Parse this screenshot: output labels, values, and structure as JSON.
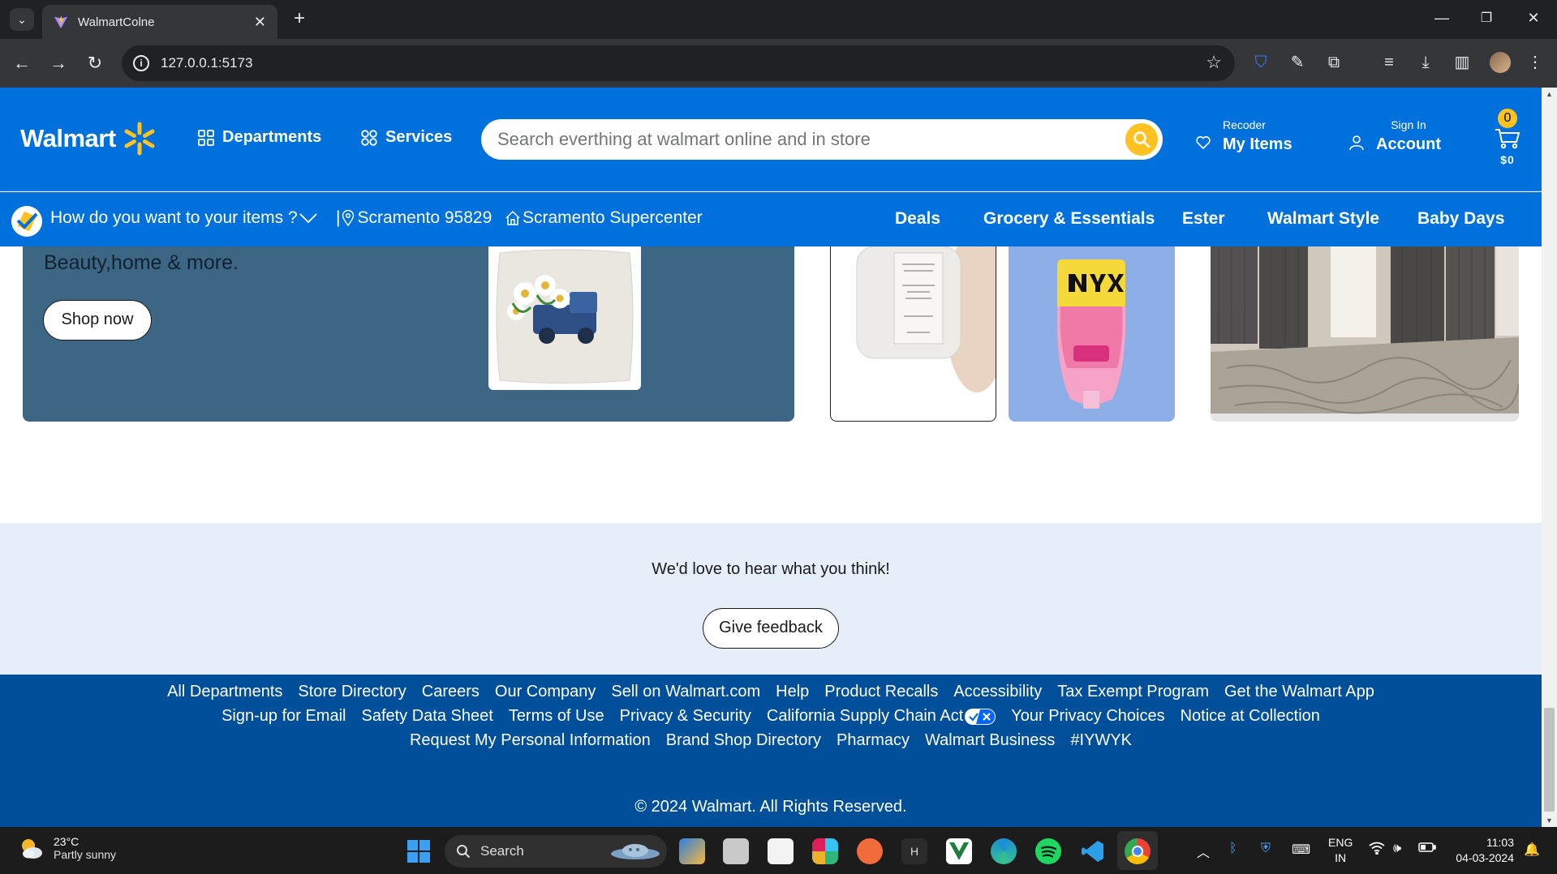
{
  "browser": {
    "tab_title": "WalmartColne",
    "url": "127.0.0.1:5173"
  },
  "header": {
    "logo_text": "Walmart",
    "departments_label": "Departments",
    "services_label": "Services",
    "search_placeholder": "Search everthing at walmart online and in store",
    "reorder_small": "Recoder",
    "reorder_big": "My Items",
    "signin_small": "Sign In",
    "signin_big": "Account",
    "cart_count": "0",
    "cart_total": "$0",
    "brand_color": "#0071dc",
    "accent_color": "#ffc220"
  },
  "sub_nav": {
    "delivery_prompt": "How do you want to your items ?",
    "zip_label": "Scramento 95829",
    "store_label": "Scramento Supercenter",
    "links": [
      "Deals",
      "Grocery & Essentials",
      "Ester",
      "Walmart Style",
      "Baby Days"
    ]
  },
  "hero": {
    "subtitle": "Beauty,home & more.",
    "cta_label": "Shop now"
  },
  "feedback": {
    "prompt": "We'd love to hear what you think!",
    "button_label": "Give feedback"
  },
  "footer": {
    "row1": [
      "All Departments",
      "Store Directory",
      "Careers",
      "Our Company",
      "Sell on Walmart.com",
      "Help",
      "Product Recalls",
      "Accessibility",
      "Tax Exempt Program",
      "Get the Walmart App"
    ],
    "row2": [
      "Sign-up for Email",
      "Safety Data Sheet",
      "Terms of Use",
      "Privacy & Security",
      "California Supply Chain Act",
      "Your Privacy Choices",
      "Notice at Collection"
    ],
    "row3": [
      "Request My Personal Information",
      "Brand Shop Directory",
      "Pharmacy",
      "Walmart Business",
      "#IYWYK"
    ],
    "copyright": "© 2024 Walmart. All Rights Reserved."
  },
  "taskbar": {
    "weather_temp": "23°C",
    "weather_desc": "Partly sunny",
    "search_label": "Search",
    "lang_top": "ENG",
    "lang_bottom": "IN",
    "time": "11:03",
    "date": "04-03-2024"
  }
}
